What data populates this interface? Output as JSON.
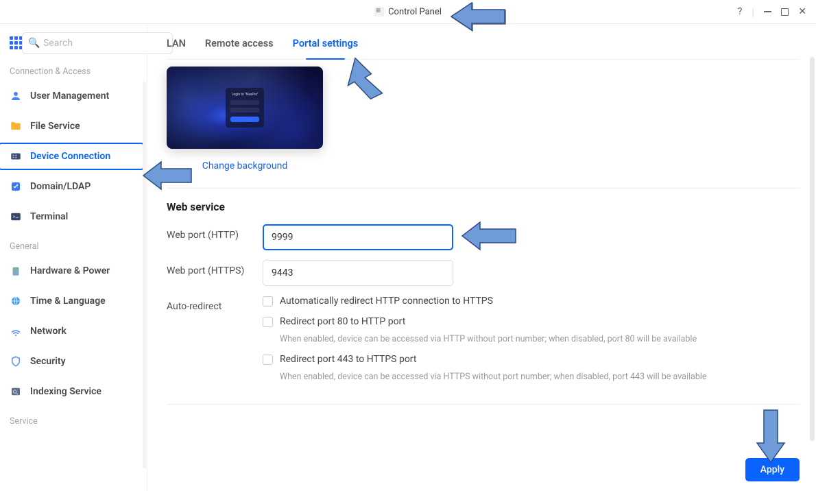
{
  "window": {
    "title": "Control Panel"
  },
  "sidebar": {
    "search_placeholder": "Search",
    "groups": [
      {
        "title": "Connection & Access"
      },
      {
        "title": "General"
      },
      {
        "title": "Service"
      }
    ],
    "items": {
      "user_management": "User Management",
      "file_service": "File Service",
      "device_connection": "Device Connection",
      "domain_ldap": "Domain/LDAP",
      "terminal": "Terminal",
      "hardware_power": "Hardware & Power",
      "time_language": "Time & Language",
      "network": "Network",
      "security": "Security",
      "indexing_service": "Indexing Service"
    }
  },
  "tabs": {
    "lan": "LAN",
    "remote": "Remote access",
    "portal": "Portal settings"
  },
  "portal": {
    "change_background": "Change background",
    "web_service_title": "Web service",
    "http_label": "Web port (HTTP)",
    "http_value": "9999",
    "https_label": "Web port (HTTPS)",
    "https_value": "9443",
    "auto_redirect_label": "Auto-redirect",
    "check1": "Automatically redirect HTTP connection to HTTPS",
    "check2": "Redirect port 80 to HTTP port",
    "check2_desc": "When enabled, device can be accessed via HTTP without port number; when disabled, port 80 will be available",
    "check3": "Redirect port 443 to HTTPS port",
    "check3_desc": "When enabled, device can be accessed via HTTPS without port number; when disabled, port 443 will be available",
    "apply": "Apply"
  }
}
